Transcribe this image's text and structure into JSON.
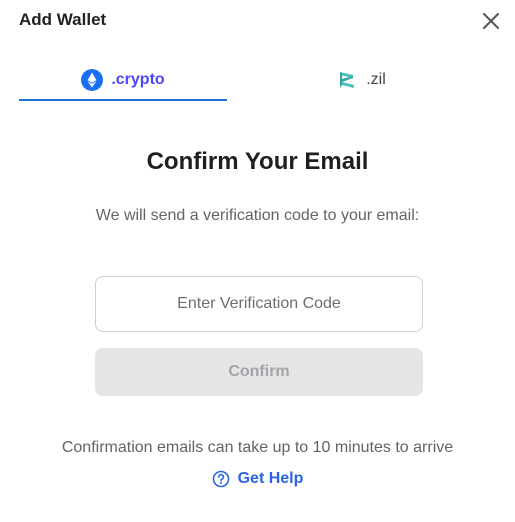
{
  "dialog": {
    "title": "Add Wallet",
    "close_icon": "close-icon"
  },
  "tabs": [
    {
      "label": ".crypto",
      "icon": "ethereum-icon",
      "active": true
    },
    {
      "label": ".zil",
      "icon": "zilliqa-icon",
      "active": false
    }
  ],
  "content": {
    "heading": "Confirm Your Email",
    "subtext": "We will send a verification code to your email:",
    "code_input": {
      "value": "",
      "placeholder": "Enter Verification Code"
    },
    "confirm_label": "Confirm",
    "footnote": "Confirmation emails can take up to 10 minutes to arrive",
    "help_label": "Get Help",
    "help_icon": "question-circle-icon"
  },
  "colors": {
    "accent_tab": "#4c47f7",
    "tab_underline": "#1f6fd8",
    "link_blue": "#2a64e0",
    "disabled_button_bg": "#e5e5e6",
    "disabled_button_text": "#a3a3a8",
    "zil_teal": "#49c1bf"
  }
}
